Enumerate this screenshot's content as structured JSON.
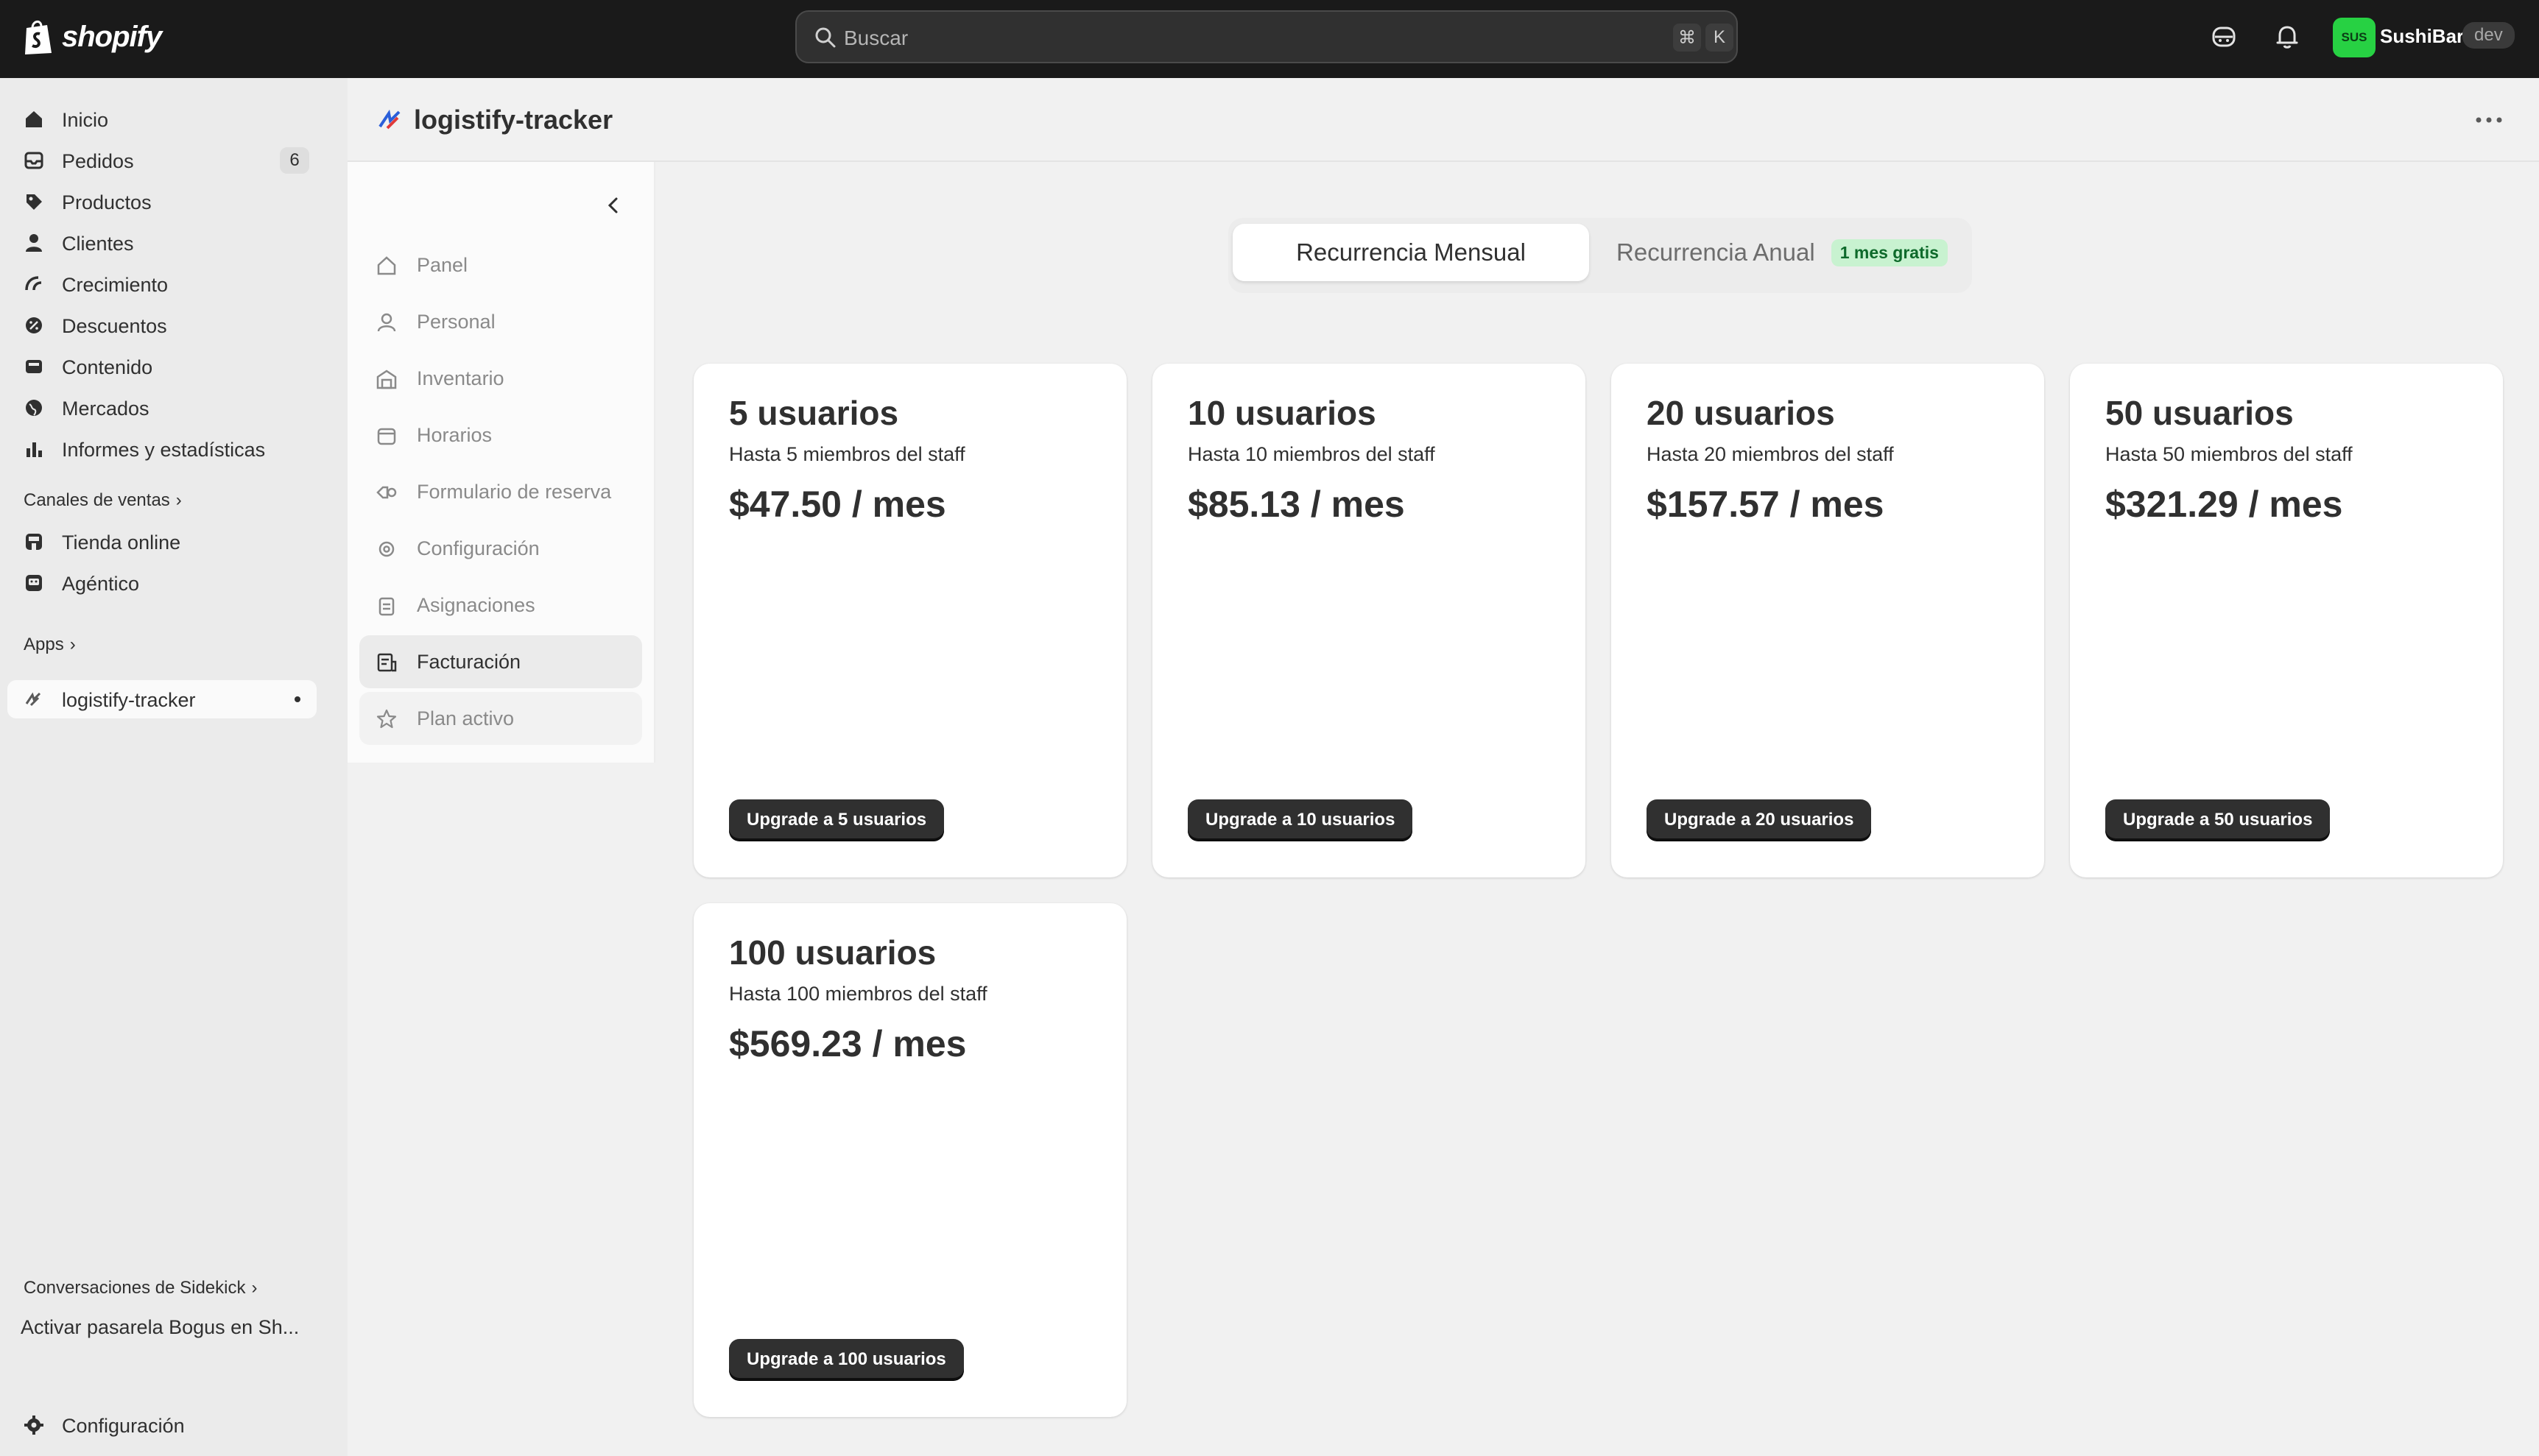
{
  "topbar": {
    "brand": "shopify",
    "search_placeholder": "Buscar",
    "shortcut_key1": "⌘",
    "shortcut_key2": "K",
    "avatar_initials": "SUS",
    "store_name": "SushiBar",
    "env_badge": "dev"
  },
  "sidebar": {
    "items": [
      {
        "label": "Inicio",
        "icon": "home-icon"
      },
      {
        "label": "Pedidos",
        "icon": "orders-icon",
        "count": "6"
      },
      {
        "label": "Productos",
        "icon": "tag-icon"
      },
      {
        "label": "Clientes",
        "icon": "person-icon"
      },
      {
        "label": "Crecimiento",
        "icon": "growth-icon"
      },
      {
        "label": "Descuentos",
        "icon": "discount-icon"
      },
      {
        "label": "Contenido",
        "icon": "content-icon"
      },
      {
        "label": "Mercados",
        "icon": "globe-icon"
      },
      {
        "label": "Informes y estadísticas",
        "icon": "chart-icon"
      }
    ],
    "sales_channels_label": "Canales de ventas",
    "channels": [
      {
        "label": "Tienda online",
        "icon": "store-icon"
      },
      {
        "label": "Agéntico",
        "icon": "agent-icon"
      }
    ],
    "apps_label": "Apps",
    "app_item": "logistify-tracker",
    "sidekick_label": "Conversaciones de Sidekick",
    "sidekick_conversation": "Activar pasarela Bogus en Sh...",
    "settings_label": "Configuración"
  },
  "app": {
    "title": "logistify-tracker",
    "subnav": [
      {
        "label": "Panel",
        "icon": "home-icon"
      },
      {
        "label": "Personal",
        "icon": "person-icon"
      },
      {
        "label": "Inventario",
        "icon": "warehouse-icon"
      },
      {
        "label": "Horarios",
        "icon": "calendar-icon"
      },
      {
        "label": "Formulario de reserva",
        "icon": "form-icon"
      },
      {
        "label": "Configuración",
        "icon": "gear-icon"
      },
      {
        "label": "Asignaciones",
        "icon": "clipboard-icon"
      },
      {
        "label": "Facturación",
        "icon": "receipt-icon"
      },
      {
        "label": "Plan activo",
        "icon": "star-icon"
      }
    ],
    "active_subnav": "Facturación"
  },
  "billing": {
    "toggle_monthly": "Recurrencia Mensual",
    "toggle_annual": "Recurrencia Anual",
    "annual_badge": "1 mes gratis",
    "plans": [
      {
        "title": "5 usuarios",
        "subtitle": "Hasta 5 miembros del staff",
        "price": "$47.50 / mes",
        "button": "Upgrade a 5 usuarios"
      },
      {
        "title": "10 usuarios",
        "subtitle": "Hasta 10 miembros del staff",
        "price": "$85.13 / mes",
        "button": "Upgrade a 10 usuarios"
      },
      {
        "title": "20 usuarios",
        "subtitle": "Hasta 20 miembros del staff",
        "price": "$157.57 / mes",
        "button": "Upgrade a 20 usuarios"
      },
      {
        "title": "50 usuarios",
        "subtitle": "Hasta 50 miembros del staff",
        "price": "$321.29 / mes",
        "button": "Upgrade a 50 usuarios"
      },
      {
        "title": "100 usuarios",
        "subtitle": "Hasta 100 miembros del staff",
        "price": "$569.23 / mes",
        "button": "Upgrade a 100 usuarios"
      }
    ]
  },
  "colors": {
    "topbar_bg": "#1a1a1a",
    "avatar_bg": "#27d143",
    "badge_bg": "#c8f2d0",
    "button_bg": "#303030"
  }
}
